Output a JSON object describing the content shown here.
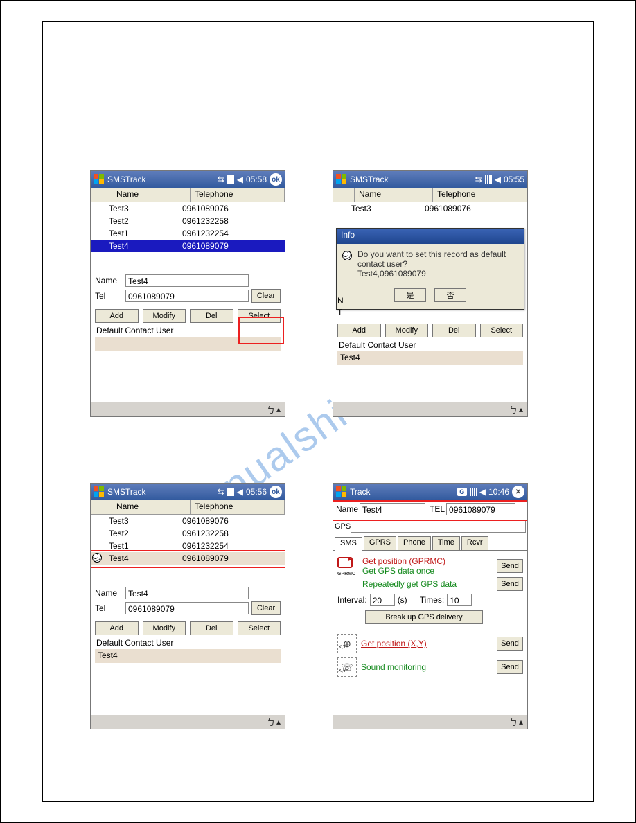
{
  "watermark": "manualshive.com",
  "screens": {
    "s1": {
      "title": "SMSTrack",
      "time": "05:58",
      "ok": "ok",
      "headers": {
        "name": "Name",
        "telephone": "Telephone"
      },
      "rows": [
        {
          "name": "Test3",
          "tel": "0961089076",
          "sel": false
        },
        {
          "name": "Test2",
          "tel": "0961232258",
          "sel": false
        },
        {
          "name": "Test1",
          "tel": "0961232254",
          "sel": false
        },
        {
          "name": "Test4",
          "tel": "0961089079",
          "sel": true
        }
      ],
      "form": {
        "name_lbl": "Name",
        "tel_lbl": "Tel",
        "name": "Test4",
        "tel": "0961089079"
      },
      "buttons": {
        "clear": "Clear",
        "add": "Add",
        "modify": "Modify",
        "del": "Del",
        "select": "Select"
      },
      "dcu_label": "Default Contact User",
      "dcu_value": ""
    },
    "s2": {
      "title": "SMSTrack",
      "time": "05:55",
      "headers": {
        "name": "Name",
        "telephone": "Telephone"
      },
      "rows": [
        {
          "name": "Test3",
          "tel": "0961089076"
        }
      ],
      "dialog": {
        "title": "Info",
        "text": "Do you want to set this record as default contact user?\nTest4,0961089079",
        "yes": "是",
        "no": "否"
      },
      "form": {
        "name_lbl": "N",
        "tel_lbl": "T"
      },
      "buttons": {
        "add": "Add",
        "modify": "Modify",
        "del": "Del",
        "select": "Select"
      },
      "dcu_label": "Default Contact User",
      "dcu_value": "Test4"
    },
    "s3": {
      "title": "SMSTrack",
      "time": "05:56",
      "ok": "ok",
      "headers": {
        "name": "Name",
        "telephone": "Telephone"
      },
      "rows": [
        {
          "name": "Test3",
          "tel": "0961089076"
        },
        {
          "name": "Test2",
          "tel": "0961232258"
        },
        {
          "name": "Test1",
          "tel": "0961232254"
        },
        {
          "name": "Test4",
          "tel": "0961089079",
          "marked": true,
          "icon": true
        }
      ],
      "form": {
        "name_lbl": "Name",
        "tel_lbl": "Tel",
        "name": "Test4",
        "tel": "0961089079"
      },
      "buttons": {
        "clear": "Clear",
        "add": "Add",
        "modify": "Modify",
        "del": "Del",
        "select": "Select"
      },
      "dcu_label": "Default Contact User",
      "dcu_value": "Test4"
    },
    "s4": {
      "title": "Track",
      "time": "10:46",
      "close": "✕",
      "g_badge": "G",
      "top": {
        "name_lbl": "Name",
        "name": "Test4",
        "tel_lbl": "TEL",
        "tel": "0961089079"
      },
      "gps_lbl": "GPS",
      "tabs": {
        "sms": "SMS",
        "gprs": "GPRS",
        "phone": "Phone",
        "time": "Time",
        "rcvr": "Rcvr"
      },
      "gprmc_label": "GPRMC",
      "cmd": {
        "get_pos_gprmc": "Get position (GPRMC)",
        "get_once": "Get GPS data once",
        "get_repeat": "Repeatedly get GPS data",
        "interval_lbl": "Interval:",
        "interval": "20",
        "unit": "(s)",
        "times_lbl": "Times:",
        "times": "10",
        "break": "Break up GPS delivery",
        "get_pos_xy": "Get position (X,Y)",
        "sound_mon": "Sound monitoring",
        "send": "Send"
      }
    }
  }
}
